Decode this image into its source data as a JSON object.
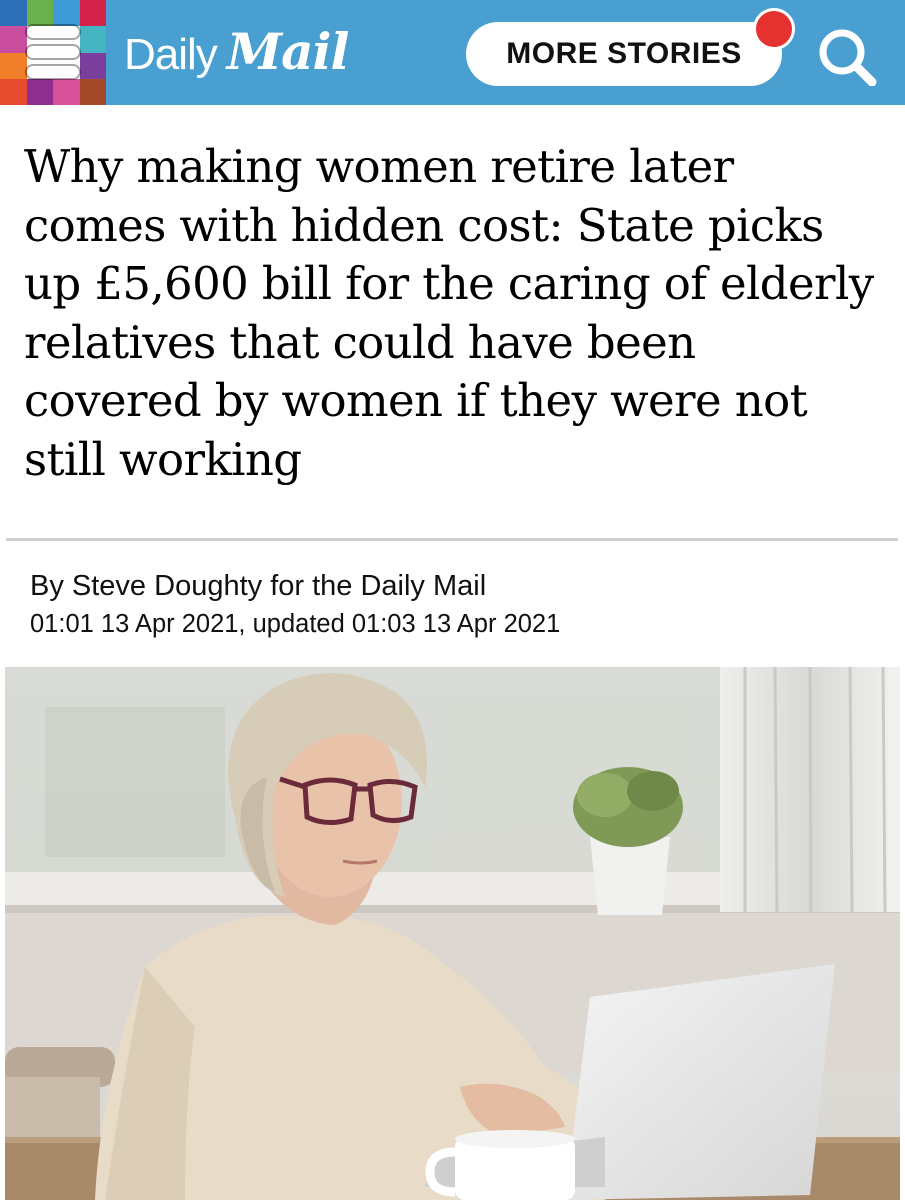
{
  "header": {
    "logo_daily": "Daily",
    "logo_mail": "Mail",
    "more_stories_label": "MORE STORIES",
    "brand_color": "#4a9fd1",
    "notification_color": "#e5312f",
    "mosaic_colors": [
      "#2b6fb7",
      "#6ab04c",
      "#3c9ad6",
      "#d3234a",
      "#c94ea0",
      "#ffffff",
      "#ffffff",
      "#45b5c4",
      "#f07f2a",
      "#ffffff",
      "#ffffff",
      "#7a3f9d",
      "#e54c2e",
      "#8e2f8f",
      "#d7509a",
      "#a24a2a"
    ]
  },
  "article": {
    "headline": "Why making women retire later comes with hidden cost: State picks up £5,600 bill for the caring of elderly relatives that could have been covered by women if they were not still working",
    "byline_prefix": "By ",
    "author": "Steve Doughty for the Daily Mail",
    "dateline": "01:01 13 Apr 2021, updated 01:03 13 Apr 2021"
  },
  "icons": {
    "menu": "hamburger-menu-icon",
    "search": "search-icon",
    "notification": "notification-dot-icon"
  }
}
